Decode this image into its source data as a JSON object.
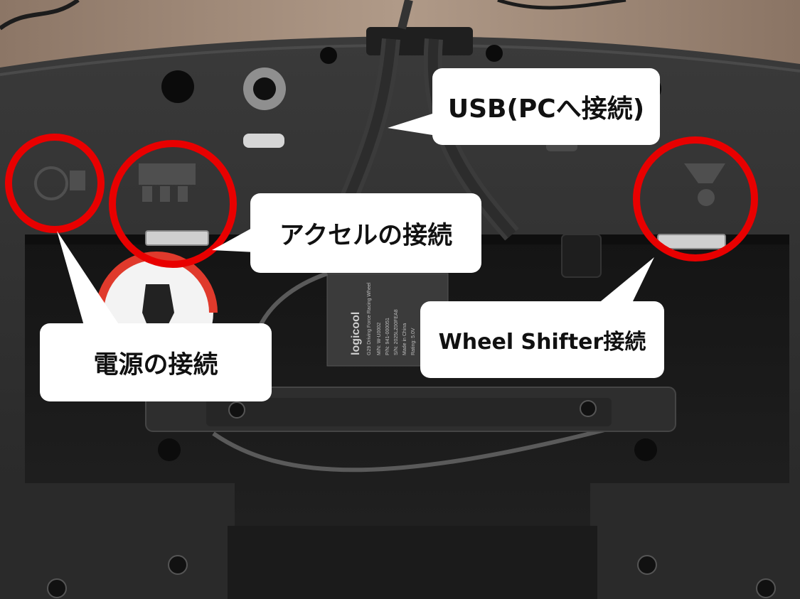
{
  "callouts": {
    "usb": "USB(PCへ接続)",
    "accelerator": "アクセルの接続",
    "wheel_shifter": "Wheel Shifter接続",
    "power": "電源の接続"
  },
  "device_label": {
    "brand": "logicool",
    "model": "G29 Driving Force Racing Wheel",
    "model_number": "M/N: W-U0002",
    "part_number": "P/N: 941-000051",
    "serial_number": "S/N: 2025LZ00FEA8",
    "origin": "Made in China",
    "rating": "Rating: 5.0V"
  },
  "colors": {
    "highlight_circle": "#e80000",
    "callout_fill": "#ffffff",
    "callout_text": "#111111",
    "housing": "#2b2b2b",
    "table": "#a08a78"
  }
}
